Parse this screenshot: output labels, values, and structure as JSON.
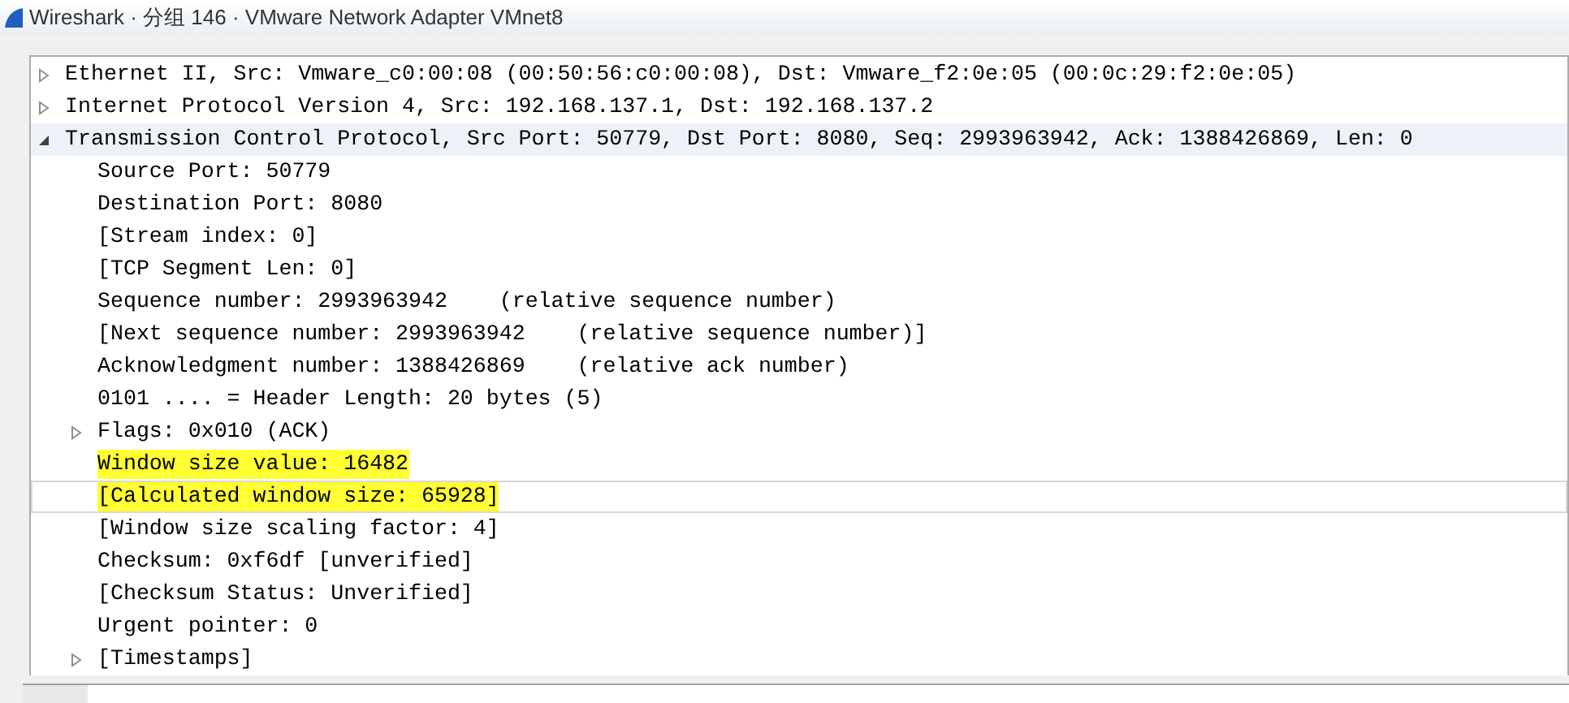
{
  "window": {
    "title": "Wireshark · 分组 146 · VMware Network Adapter VMnet8"
  },
  "tree": [
    {
      "label": "Ethernet II, Src: Vmware_c0:00:08 (00:50:56:c0:00:08), Dst: Vmware_f2:0e:05 (00:0c:29:f2:0e:05)",
      "expanded": false,
      "shaded": false,
      "selected": false,
      "highlighted": false
    },
    {
      "label": "Internet Protocol Version 4, Src: 192.168.137.1, Dst: 192.168.137.2",
      "expanded": false,
      "shaded": false,
      "selected": false,
      "highlighted": false
    },
    {
      "label": "Transmission Control Protocol, Src Port: 50779, Dst Port: 8080, Seq: 2993963942, Ack: 1388426869, Len: 0",
      "expanded": true,
      "shaded": true,
      "selected": false,
      "highlighted": false,
      "children": [
        {
          "label": "Source Port: 50779",
          "shaded": false,
          "selected": false,
          "highlighted": false
        },
        {
          "label": "Destination Port: 8080",
          "shaded": false,
          "selected": false,
          "highlighted": false
        },
        {
          "label": "[Stream index: 0]",
          "shaded": false,
          "selected": false,
          "highlighted": false
        },
        {
          "label": "[TCP Segment Len: 0]",
          "shaded": false,
          "selected": false,
          "highlighted": false
        },
        {
          "label": "Sequence number: 2993963942    (relative sequence number)",
          "shaded": false,
          "selected": false,
          "highlighted": false
        },
        {
          "label": "[Next sequence number: 2993963942    (relative sequence number)]",
          "shaded": false,
          "selected": false,
          "highlighted": false
        },
        {
          "label": "Acknowledgment number: 1388426869    (relative ack number)",
          "shaded": false,
          "selected": false,
          "highlighted": false
        },
        {
          "label": "0101 .... = Header Length: 20 bytes (5)",
          "shaded": false,
          "selected": false,
          "highlighted": false
        },
        {
          "label": "Flags: 0x010 (ACK)",
          "expanded": false,
          "shaded": false,
          "selected": false,
          "highlighted": false
        },
        {
          "label": "Window size value: 16482",
          "shaded": false,
          "selected": false,
          "highlighted": true
        },
        {
          "label": "[Calculated window size: 65928]",
          "shaded": false,
          "selected": true,
          "highlighted": true
        },
        {
          "label": "[Window size scaling factor: 4]",
          "shaded": false,
          "selected": false,
          "highlighted": false
        },
        {
          "label": "Checksum: 0xf6df [unverified]",
          "shaded": false,
          "selected": false,
          "highlighted": false
        },
        {
          "label": "[Checksum Status: Unverified]",
          "shaded": false,
          "selected": false,
          "highlighted": false
        },
        {
          "label": "Urgent pointer: 0",
          "shaded": false,
          "selected": false,
          "highlighted": false
        },
        {
          "label": "[Timestamps]",
          "expanded": false,
          "shaded": false,
          "selected": false,
          "highlighted": false
        }
      ]
    }
  ]
}
